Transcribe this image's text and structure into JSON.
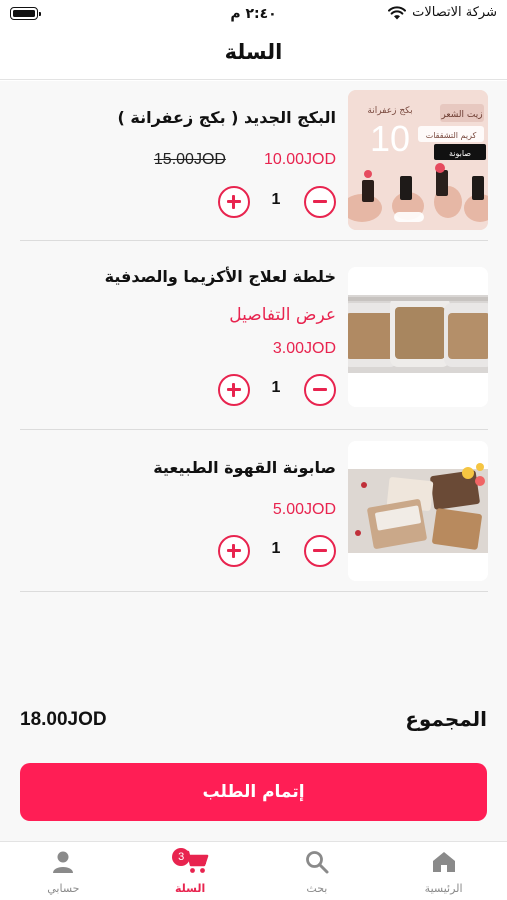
{
  "status_bar": {
    "carrier": "شركة الاتصالات",
    "time": "٢:٤٠ م"
  },
  "header": {
    "title": "السلة"
  },
  "cart": {
    "items": [
      {
        "title": "البكج الجديد  ( بكج زعفرانة )",
        "price": "10.00JOD",
        "old_price": "15.00JOD",
        "quantity": "1",
        "thumb_texts": [
          "بكج زعفرانة",
          "10",
          "زيت الشعر",
          "كريم التشققات",
          "صابونة"
        ],
        "thumb_icon": "product-collage-image"
      },
      {
        "title": "خلطة لعلاج الأكزيما والصدفية",
        "details_link": "عرض التفاصيل",
        "price": "3.00JOD",
        "quantity": "1",
        "thumb_icon": "cream-jars-image"
      },
      {
        "title": "صابونة القهوة الطبيعية",
        "price": "5.00JOD",
        "quantity": "1",
        "thumb_icon": "soap-bars-image"
      }
    ]
  },
  "summary": {
    "total_label": "المجموع",
    "total_value": "18.00JOD",
    "checkout_label": "إتمام الطلب"
  },
  "tab_bar": {
    "tabs": [
      {
        "label": "الرئيسية",
        "icon": "home-icon"
      },
      {
        "label": "بحث",
        "icon": "search-icon"
      },
      {
        "label": "السلة",
        "icon": "cart-icon",
        "badge": "3"
      },
      {
        "label": "حسابي",
        "icon": "user-icon"
      }
    ]
  },
  "colors": {
    "accent": "#e8244f",
    "checkout": "#ff1e55",
    "background": "#f8f8f8",
    "tab_inactive": "#8a8a8a"
  }
}
